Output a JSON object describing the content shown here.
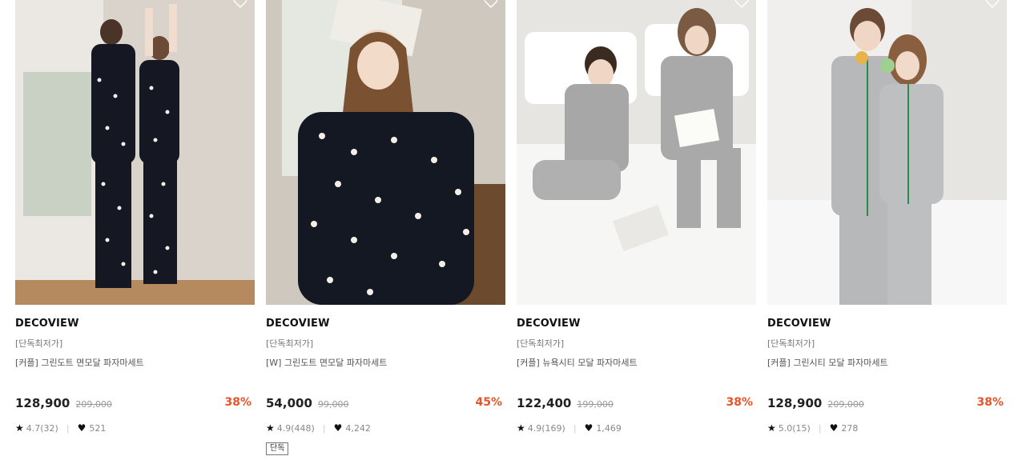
{
  "products": [
    {
      "brand": "DECOVIEW",
      "tag": "[단독최저가]",
      "name": "[커플] 그린도트 면모달 파자마세트",
      "price": "128,900",
      "original_price": "209,000",
      "discount": "38%",
      "rating": "4.7(32)",
      "likes": "521",
      "badge": ""
    },
    {
      "brand": "DECOVIEW",
      "tag": "[단독최저가]",
      "name": "[W] 그린도트 면모달 파자마세트",
      "price": "54,000",
      "original_price": "99,000",
      "discount": "45%",
      "rating": "4.9(448)",
      "likes": "4,242",
      "badge": "단독"
    },
    {
      "brand": "DECOVIEW",
      "tag": "[단독최저가]",
      "name": "[커플] 뉴욕시티 모달 파자마세트",
      "price": "122,400",
      "original_price": "199,000",
      "discount": "38%",
      "rating": "4.9(169)",
      "likes": "1,469",
      "badge": ""
    },
    {
      "brand": "DECOVIEW",
      "tag": "[단독최저가]",
      "name": "[커플] 그린시티 모달 파자마세트",
      "price": "128,900",
      "original_price": "209,000",
      "discount": "38%",
      "rating": "5.0(15)",
      "likes": "278",
      "badge": ""
    }
  ],
  "colors": {
    "discount": "#e8542a",
    "price": "#222222",
    "muted": "#999999"
  },
  "icons": {
    "wishlist": "heart-outline-icon",
    "rating": "star-icon",
    "likes": "heart-icon"
  }
}
